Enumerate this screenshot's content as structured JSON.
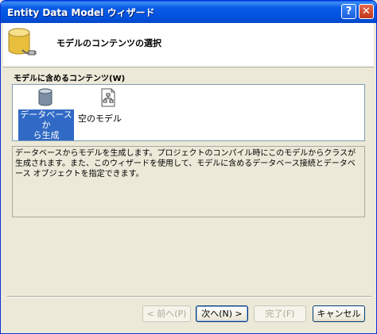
{
  "window": {
    "title": "Entity Data Model ウィザード"
  },
  "titlebar_buttons": {
    "help": "?",
    "close": "✕"
  },
  "header": {
    "title": "モデルのコンテンツの選択",
    "icon": "database-connection-icon"
  },
  "content_section": {
    "label": "モデルに含めるコンテンツ(W)",
    "items": [
      {
        "label_line1": "データベースか",
        "label_line2": "ら生成",
        "icon": "database-icon",
        "selected": true
      },
      {
        "label": "空のモデル",
        "icon": "empty-model-icon",
        "selected": false
      }
    ]
  },
  "description": "データベースからモデルを生成します。プロジェクトのコンパイル時にこのモデルからクラスが生成されます。また、このウィザードを使用して、モデルに含めるデータベース接続とデータベース オブジェクトを指定できます。",
  "buttons": {
    "back": "< 前へ(P)",
    "next": "次へ(N) >",
    "finish": "完了(F)",
    "cancel": "キャンセル"
  },
  "colors": {
    "selection": "#316ac5",
    "titlebar": "#0053e1",
    "dialog_bg": "#ece9d8"
  }
}
